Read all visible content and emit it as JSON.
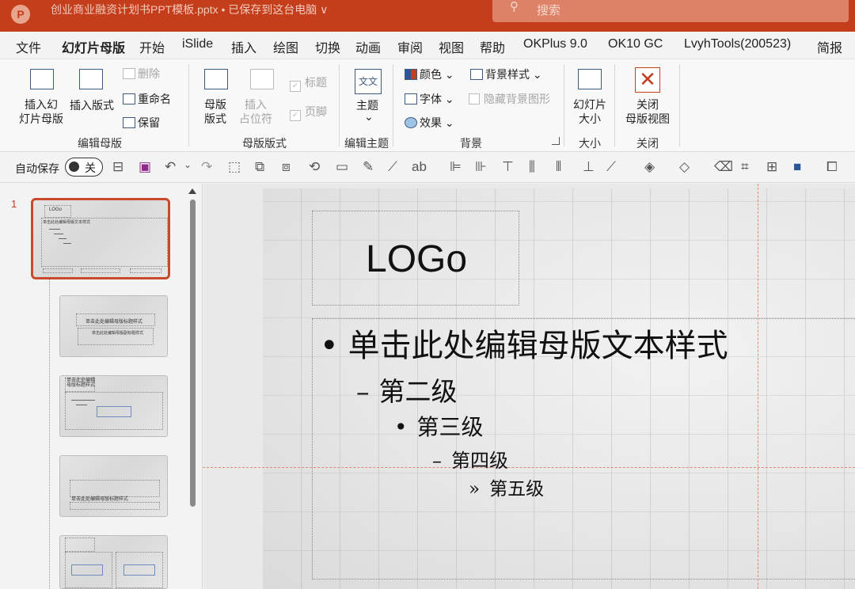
{
  "titlebar": {
    "app_icon": "P",
    "doc_title": "创业商业融资计划书PPT模板.pptx • 已保存到这台电脑 ∨",
    "search_placeholder": "搜索"
  },
  "menu_tabs": [
    "文件",
    "幻灯片母版",
    "开始",
    "iSlide",
    "插入",
    "绘图",
    "切换",
    "动画",
    "审阅",
    "视图",
    "帮助",
    "OKPlus 9.0",
    "OK10 GC",
    "LvyhTools(200523)",
    "简报"
  ],
  "ribbon": {
    "edit_master": {
      "insert_slide_master": "插入幻\n灯片母版",
      "insert_layout": "插入版式",
      "delete": "删除",
      "rename": "重命名",
      "preserve": "保留",
      "label": "编辑母版"
    },
    "master_layout": {
      "master_layout_btn": "母版\n版式",
      "insert_placeholder": "插入\n占位符",
      "title_check": "标题",
      "footer_check": "页脚",
      "label": "母版版式"
    },
    "edit_theme": {
      "theme_btn": "主题",
      "label": "编辑主题"
    },
    "background": {
      "colors": "颜色",
      "fonts": "字体",
      "effects": "效果",
      "background_styles": "背景样式",
      "hide_background": "隐藏背景图形",
      "label": "背景"
    },
    "size": {
      "slide_size": "幻灯片\n大小",
      "label": "大小"
    },
    "close": {
      "close_master_view": "关闭\n母版视图",
      "label": "关闭"
    }
  },
  "qat": {
    "autosave_label": "自动保存",
    "autosave_state": "关"
  },
  "thumbnails": {
    "slide_number": "1",
    "master_logo": "LOGo",
    "master_text": "单击此处编辑母版文本样式",
    "t2_title": "单击此处编辑母版标题样式",
    "t2_sub": "单击此处编辑母版副标题样式",
    "t3_title": "单击此处编辑母版标题样式",
    "t4_title": "单击此处编辑母版标题样式"
  },
  "slide": {
    "logo": "LOGo",
    "level1": "单击此处编辑母版文本样式",
    "level2": "第二级",
    "level3": "第三级",
    "level4": "第四级",
    "level5": "第五级",
    "bullet1": "•",
    "bullet2": "–",
    "bullet3": "•",
    "bullet4": "–",
    "bullet5": "»"
  },
  "colors": {
    "accent": "#c43e1c",
    "selected_thumb": "#c84a2c"
  }
}
